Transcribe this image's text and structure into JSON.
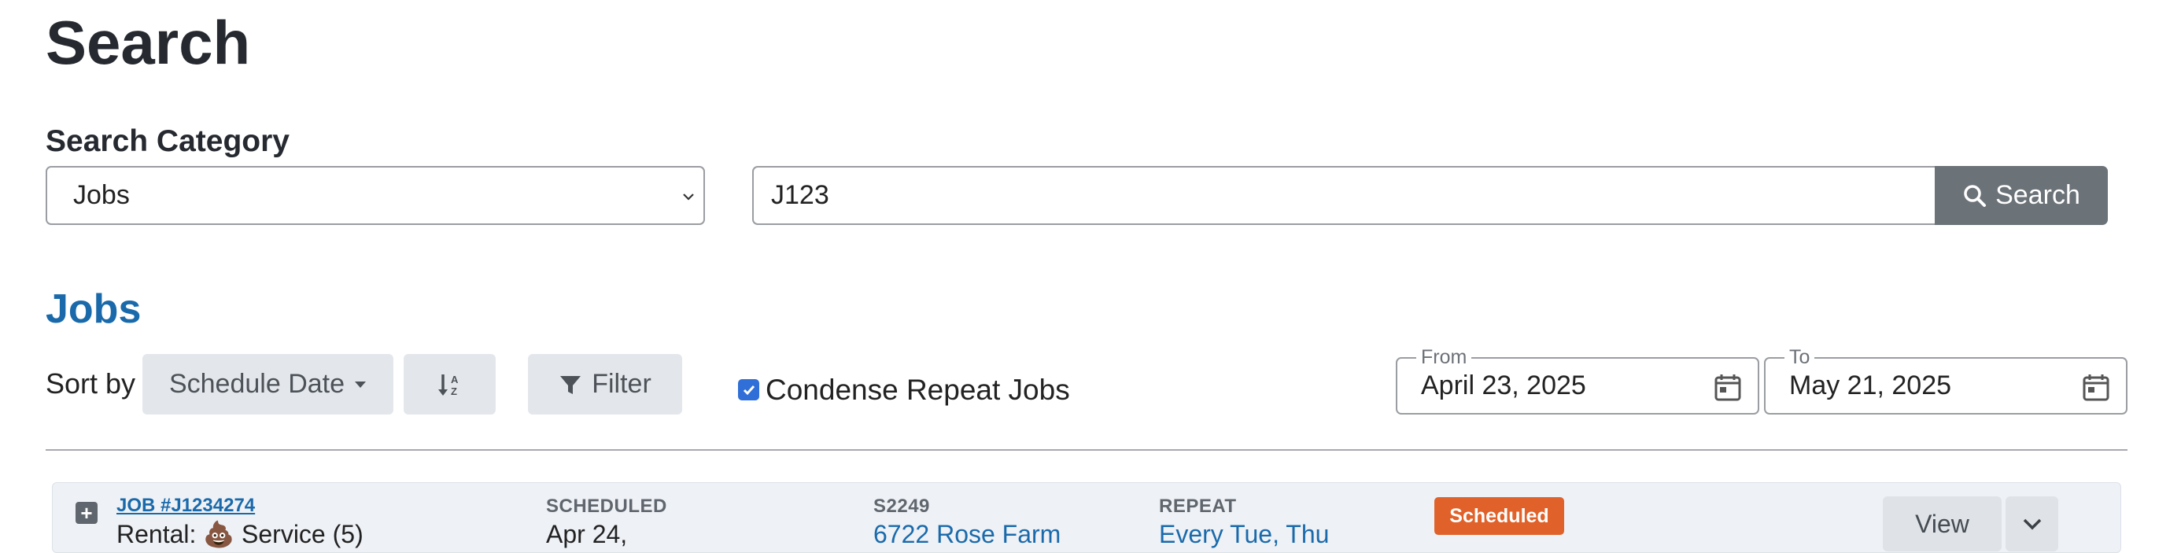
{
  "page": {
    "title": "Search"
  },
  "search": {
    "category_label": "Search Category",
    "category_value": "Jobs",
    "query_value": "J123",
    "button_label": "Search"
  },
  "jobs": {
    "section_title": "Jobs",
    "sort_by_label": "Sort by",
    "sort_field": "Schedule Date",
    "filter_label": "Filter",
    "condense_label": "Condense Repeat Jobs",
    "condense_checked": true,
    "from_label": "From",
    "from_value": "April 23, 2025",
    "to_label": "To",
    "to_value": "May 21, 2025",
    "rows": [
      {
        "job_id": "JOB #J1234274",
        "description": "Rental: 💩 Service (5)",
        "scheduled_label": "SCHEDULED",
        "scheduled_value": "Apr 24,",
        "site_label": "S2249",
        "site_value": "6722 Rose Farm",
        "repeat_label": "REPEAT",
        "repeat_value": "Every Tue, Thu",
        "status": "Scheduled",
        "view_label": "View"
      }
    ]
  },
  "colors": {
    "link": "#1a6aab",
    "status_scheduled": "#e0622a",
    "search_button": "#6b7278",
    "checkbox": "#2f6fd7"
  },
  "icons": {
    "select": "chevron-down-icon",
    "search": "search-icon",
    "sort_caret": "caret-down-icon",
    "sort_direction": "sort-ascending-icon",
    "filter": "filter-icon",
    "calendar": "calendar-icon",
    "expand": "plus-icon",
    "more": "chevron-down-icon"
  }
}
